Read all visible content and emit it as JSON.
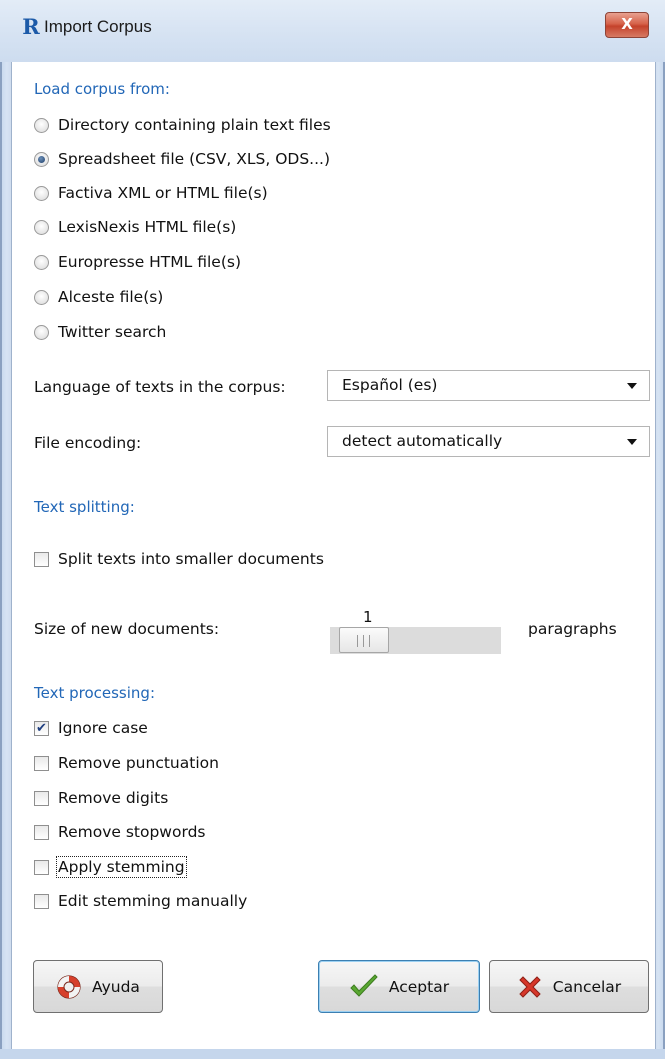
{
  "window": {
    "title": "Import Corpus",
    "close_glyph": "X"
  },
  "load_section": {
    "heading": "Load corpus from:",
    "options": [
      {
        "label": "Directory containing plain text files",
        "selected": false
      },
      {
        "label": "Spreadsheet file (CSV, XLS, ODS...)",
        "selected": true
      },
      {
        "label": "Factiva XML or HTML file(s)",
        "selected": false
      },
      {
        "label": "LexisNexis HTML file(s)",
        "selected": false
      },
      {
        "label": "Europresse HTML file(s)",
        "selected": false
      },
      {
        "label": "Alceste file(s)",
        "selected": false
      },
      {
        "label": "Twitter search",
        "selected": false
      }
    ]
  },
  "language": {
    "label": "Language of texts in the corpus:",
    "value": "Español (es)"
  },
  "encoding": {
    "label": "File encoding:",
    "value": "detect automatically"
  },
  "splitting": {
    "heading": "Text splitting:",
    "split_label": "Split texts into smaller documents",
    "split_checked": false,
    "size_label": "Size of new documents:",
    "size_value": "1",
    "size_unit": "paragraphs"
  },
  "processing": {
    "heading": "Text processing:",
    "options": [
      {
        "label": "Ignore case",
        "checked": true
      },
      {
        "label": "Remove punctuation",
        "checked": false
      },
      {
        "label": "Remove digits",
        "checked": false
      },
      {
        "label": "Remove stopwords",
        "checked": false
      },
      {
        "label": "Apply stemming",
        "checked": false
      },
      {
        "label": "Edit stemming manually",
        "checked": false
      }
    ]
  },
  "buttons": {
    "help": "Ayuda",
    "ok": "Aceptar",
    "cancel": "Cancelar"
  },
  "colors": {
    "section_heading": "#2267b7",
    "ok_check": "#5aa832",
    "cancel_x": "#d6372a"
  },
  "icons": {
    "app": "r-logo-icon",
    "help": "lifebuoy-icon",
    "ok": "checkmark-icon",
    "cancel": "red-x-icon"
  }
}
